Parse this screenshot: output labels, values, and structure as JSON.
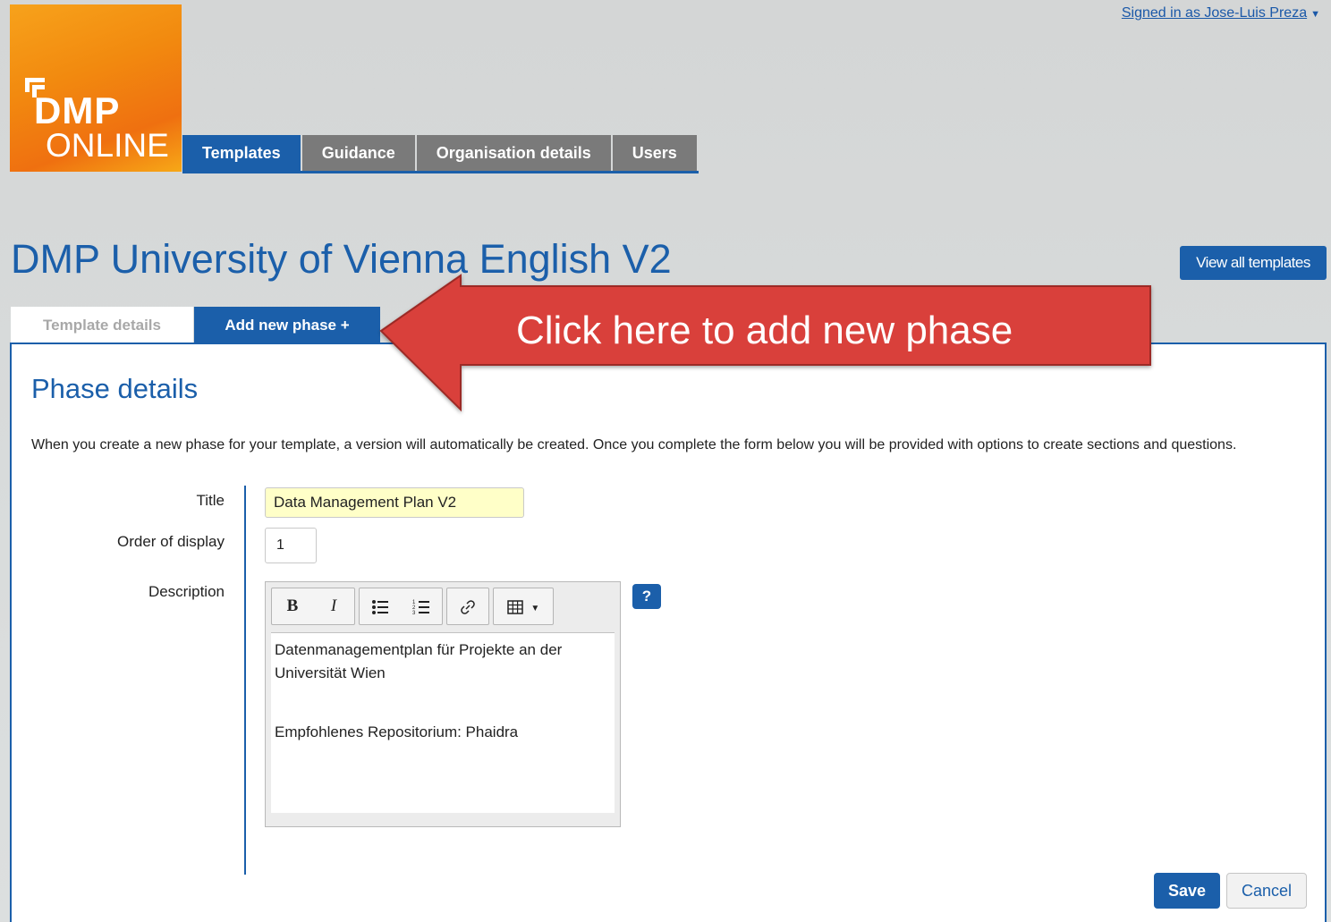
{
  "header": {
    "logo_text_top": "DMP",
    "logo_text_bottom": "ONLINE",
    "signed_in": "Signed in as Jose-Luis Preza",
    "caret_icon": "caret-down-icon"
  },
  "nav": {
    "tabs": [
      {
        "label": "Templates",
        "active": true
      },
      {
        "label": "Guidance",
        "active": false
      },
      {
        "label": "Organisation details",
        "active": false
      },
      {
        "label": "Users",
        "active": false
      }
    ]
  },
  "page": {
    "title": "DMP University of Vienna English V2",
    "view_all_label": "View all templates"
  },
  "subtabs": {
    "details": "Template details",
    "add_phase": "Add new phase +"
  },
  "annotation": {
    "text": "Click here to add new phase",
    "color": "#d9403a"
  },
  "form": {
    "heading": "Phase details",
    "intro": "When you create a new phase for your template, a version will automatically be created. Once you complete the form below you will be provided with options to create sections and questions.",
    "title_label": "Title",
    "title_value": "Data Management Plan V2",
    "order_label": "Order of display",
    "order_value": "1",
    "description_label": "Description",
    "toolbar": {
      "bold": "B",
      "italic": "I",
      "icons": [
        "bullet-list-icon",
        "numbered-list-icon",
        "link-icon",
        "table-icon"
      ]
    },
    "description_lines": [
      "Datenmanagementplan für Projekte an der Universität Wien",
      "Empfohlenes Repositorium: Phaidra"
    ],
    "help_label": "?",
    "save_label": "Save",
    "cancel_label": "Cancel"
  },
  "colors": {
    "primary": "#1b5faa",
    "tab_inactive": "#7a7a7a",
    "title_input_bg": "#ffffc8",
    "logo_orange": "#f28a0f"
  }
}
